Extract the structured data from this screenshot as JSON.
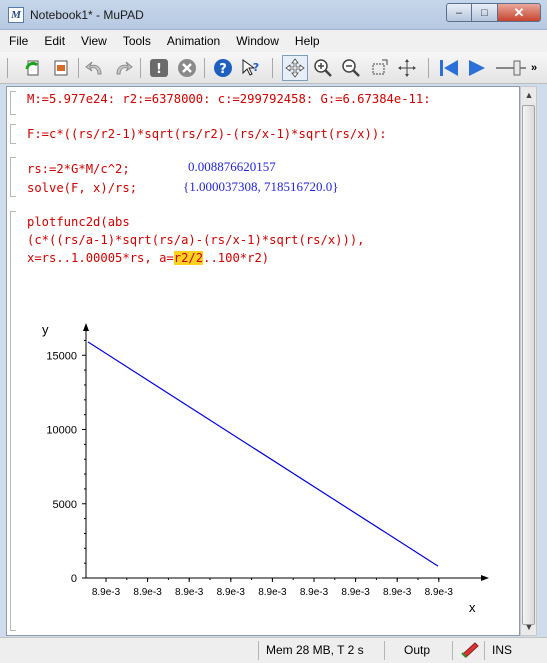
{
  "window": {
    "title": "Notebook1* - MuPAD",
    "buttons": {
      "minimize": "–",
      "maximize": "□",
      "close": "✕"
    }
  },
  "menu": [
    "File",
    "Edit",
    "View",
    "Tools",
    "Animation",
    "Window",
    "Help"
  ],
  "toolbar_icons": [
    "new-notebook-icon",
    "open-icon",
    "undo-icon",
    "redo-icon",
    "evaluate-icon",
    "stop-icon",
    "help-icon",
    "context-help-icon",
    "move-icon",
    "zoom-in-icon",
    "zoom-out-icon",
    "crop-icon",
    "rotate-icon",
    "step-back-icon",
    "play-icon",
    "slider-icon",
    "overflow-icon"
  ],
  "notebook": {
    "line1": "M:=5.977e24: r2:=6378000: c:=299792458: G:=6.67384e-11:",
    "line2": "F:=c*((rs/r2-1)*sqrt(rs/r2)-(rs/x-1)*sqrt(rs/x)):",
    "line3": "rs:=2*G*M/c^2;",
    "result3": "0.008876620157",
    "line4": "solve(F, x)/rs;",
    "result4": "{1.000037308, 718516720.0}",
    "line5": "plotfunc2d(abs",
    "line6": "(c*((rs/a-1)*sqrt(rs/a)-(rs/x-1)*sqrt(rs/x))),",
    "line7_a": "x=rs..1.00005*rs, a=",
    "line7_hl": "r2/2",
    "line7_b": "..100*r2)"
  },
  "chart_data": {
    "type": "line",
    "xlabel": "x",
    "ylabel": "y",
    "ylim": [
      0,
      16500
    ],
    "yticks": [
      0,
      5000,
      10000,
      15000
    ],
    "ytick_labels": [
      "0",
      "5000",
      "10000",
      "15000"
    ],
    "xtick_labels": [
      "8.9e-3",
      "8.9e-3",
      "8.9e-3",
      "8.9e-3",
      "8.9e-3",
      "8.9e-3",
      "8.9e-3",
      "8.9e-3",
      "8.9e-3"
    ],
    "xlim": [
      0,
      1
    ],
    "series": [
      {
        "x": [
          0.0,
          0.9
        ],
        "y": [
          15900,
          800
        ]
      }
    ],
    "color": "#0000e0"
  },
  "status": {
    "memory": "Mem 28 MB, T 2 s",
    "output": "Outp",
    "mode": "INS"
  }
}
